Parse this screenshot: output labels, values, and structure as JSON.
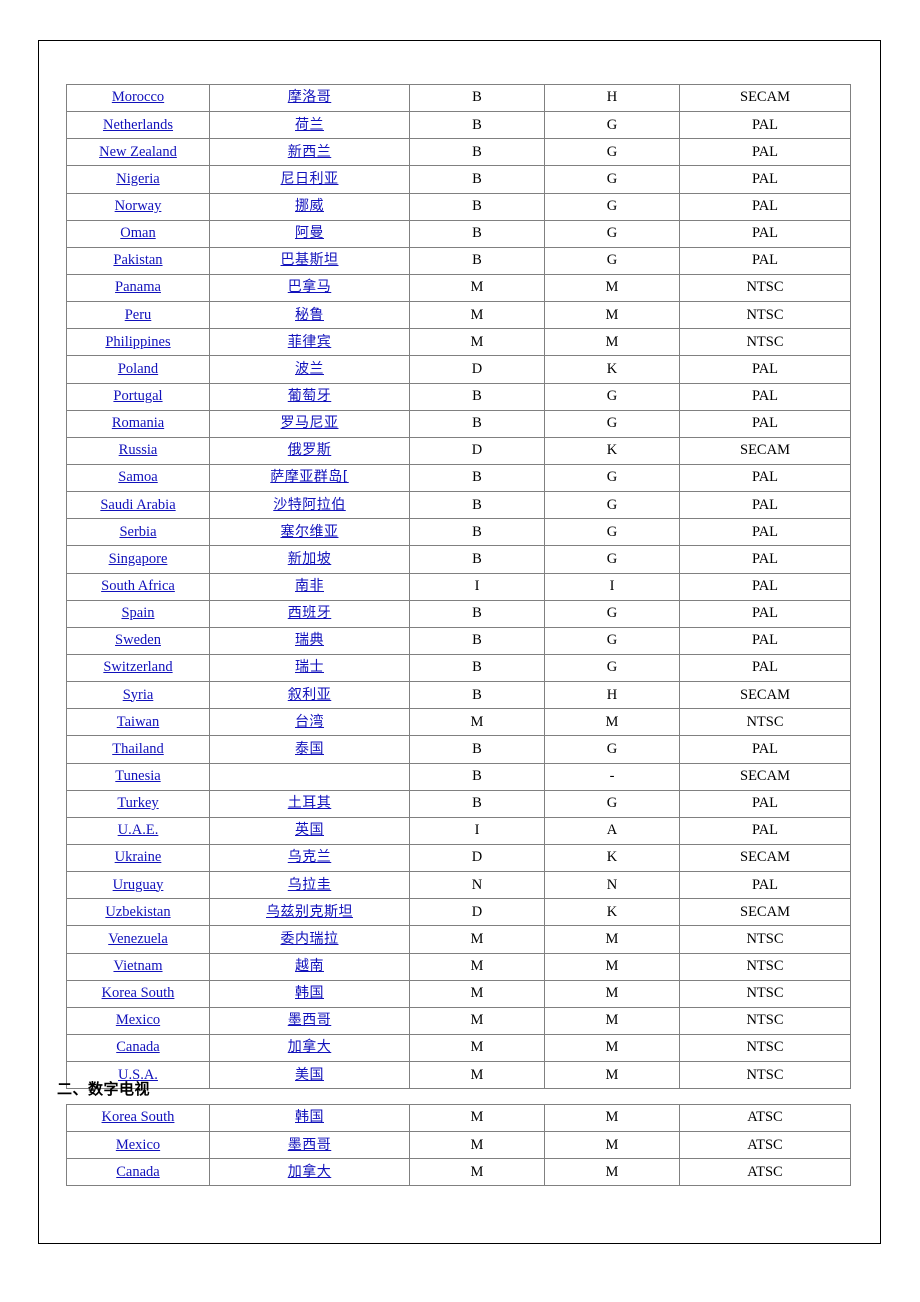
{
  "document": {
    "language": "zh-CN",
    "link_color": "#1111bb",
    "border_color": "#808080",
    "page_border_color": "#000000"
  },
  "analog_table": {
    "name": "analog-tv-standards-table",
    "columns": [
      "country_en",
      "country_zh",
      "video_system",
      "audio_system",
      "color_standard"
    ],
    "rows": [
      {
        "en": "Morocco",
        "zh": "摩洛哥",
        "video": "B",
        "audio": "H",
        "std": "SECAM"
      },
      {
        "en": "Netherlands",
        "zh": "荷兰",
        "video": "B",
        "audio": "G",
        "std": "PAL"
      },
      {
        "en": "New Zealand",
        "zh": "新西兰",
        "video": "B",
        "audio": "G",
        "std": "PAL"
      },
      {
        "en": "Nigeria",
        "zh": "尼日利亚",
        "video": "B",
        "audio": "G",
        "std": "PAL"
      },
      {
        "en": "Norway",
        "zh": "挪威",
        "video": "B",
        "audio": "G",
        "std": "PAL"
      },
      {
        "en": "Oman",
        "zh": "阿曼",
        "video": "B",
        "audio": "G",
        "std": "PAL"
      },
      {
        "en": "Pakistan",
        "zh": "巴基斯坦",
        "video": "B",
        "audio": "G",
        "std": "PAL"
      },
      {
        "en": "Panama",
        "zh": "巴拿马",
        "video": "M",
        "audio": "M",
        "std": "NTSC"
      },
      {
        "en": "Peru",
        "zh": "秘鲁",
        "video": "M",
        "audio": "M",
        "std": "NTSC"
      },
      {
        "en": "Philippines",
        "zh": "菲律宾",
        "video": "M",
        "audio": "M",
        "std": "NTSC"
      },
      {
        "en": "Poland",
        "zh": "波兰",
        "video": "D",
        "audio": "K",
        "std": "PAL"
      },
      {
        "en": "Portugal",
        "zh": "葡萄牙",
        "video": "B",
        "audio": "G",
        "std": "PAL"
      },
      {
        "en": "Romania",
        "zh": "罗马尼亚",
        "video": "B",
        "audio": "G",
        "std": "PAL"
      },
      {
        "en": "Russia",
        "zh": "俄罗斯",
        "video": "D",
        "audio": "K",
        "std": "SECAM"
      },
      {
        "en": "Samoa",
        "zh": "萨摩亚群岛[",
        "video": "B",
        "audio": "G",
        "std": "PAL"
      },
      {
        "en": "Saudi Arabia",
        "zh": "沙特阿拉伯",
        "video": "B",
        "audio": "G",
        "std": "PAL"
      },
      {
        "en": "Serbia",
        "zh": "塞尔维亚",
        "video": "B",
        "audio": "G",
        "std": "PAL"
      },
      {
        "en": "Singapore",
        "zh": "新加坡",
        "video": "B",
        "audio": "G",
        "std": "PAL"
      },
      {
        "en": "South Africa",
        "zh": "南非",
        "video": "I",
        "audio": "I",
        "std": "PAL"
      },
      {
        "en": "Spain",
        "zh": "西班牙",
        "video": "B",
        "audio": "G",
        "std": "PAL"
      },
      {
        "en": "Sweden",
        "zh": "瑞典",
        "video": "B",
        "audio": "G",
        "std": "PAL"
      },
      {
        "en": "Switzerland",
        "zh": "瑞士",
        "video": "B",
        "audio": "G",
        "std": "PAL"
      },
      {
        "en": "Syria",
        "zh": "叙利亚",
        "video": "B",
        "audio": "H",
        "std": "SECAM"
      },
      {
        "en": "Taiwan",
        "zh": "台湾",
        "video": "M",
        "audio": "M",
        "std": "NTSC"
      },
      {
        "en": "Thailand",
        "zh": "泰国",
        "video": "B",
        "audio": "G",
        "std": "PAL"
      },
      {
        "en": "Tunesia",
        "zh": "",
        "video": "B",
        "audio": "-",
        "std": "SECAM"
      },
      {
        "en": "Turkey",
        "zh": "土耳其",
        "video": "B",
        "audio": "G",
        "std": "PAL"
      },
      {
        "en": "U.A.E.",
        "zh": "英国",
        "video": "I",
        "audio": "A",
        "std": "PAL"
      },
      {
        "en": "Ukraine",
        "zh": "乌克兰",
        "video": "D",
        "audio": "K",
        "std": "SECAM"
      },
      {
        "en": "Uruguay",
        "zh": "乌拉圭",
        "video": "N",
        "audio": "N",
        "std": "PAL"
      },
      {
        "en": "Uzbekistan",
        "zh": "乌兹别克斯坦",
        "video": "D",
        "audio": "K",
        "std": "SECAM"
      },
      {
        "en": "Venezuela",
        "zh": "委内瑞拉",
        "video": "M",
        "audio": "M",
        "std": "NTSC"
      },
      {
        "en": "Vietnam",
        "zh": "越南",
        "video": "M",
        "audio": "M",
        "std": "NTSC"
      },
      {
        "en": "Korea South",
        "zh": "韩国",
        "video": "M",
        "audio": "M",
        "std": "NTSC"
      },
      {
        "en": "Mexico",
        "zh": "墨西哥",
        "video": "M",
        "audio": "M",
        "std": "NTSC"
      },
      {
        "en": "Canada",
        "zh": "加拿大",
        "video": "M",
        "audio": "M",
        "std": "NTSC"
      },
      {
        "en": "U.S.A.",
        "zh": "美国",
        "video": "M",
        "audio": "M",
        "std": "NTSC"
      }
    ]
  },
  "digital_section": {
    "heading": "二、数字电视",
    "table": {
      "name": "digital-tv-standards-table",
      "rows": [
        {
          "en": "Korea South",
          "zh": "韩国",
          "video": "M",
          "audio": "M",
          "std": "ATSC"
        },
        {
          "en": "Mexico",
          "zh": "墨西哥",
          "video": "M",
          "audio": "M",
          "std": "ATSC"
        },
        {
          "en": "Canada",
          "zh": "加拿大",
          "video": "M",
          "audio": "M",
          "std": "ATSC"
        }
      ]
    }
  }
}
